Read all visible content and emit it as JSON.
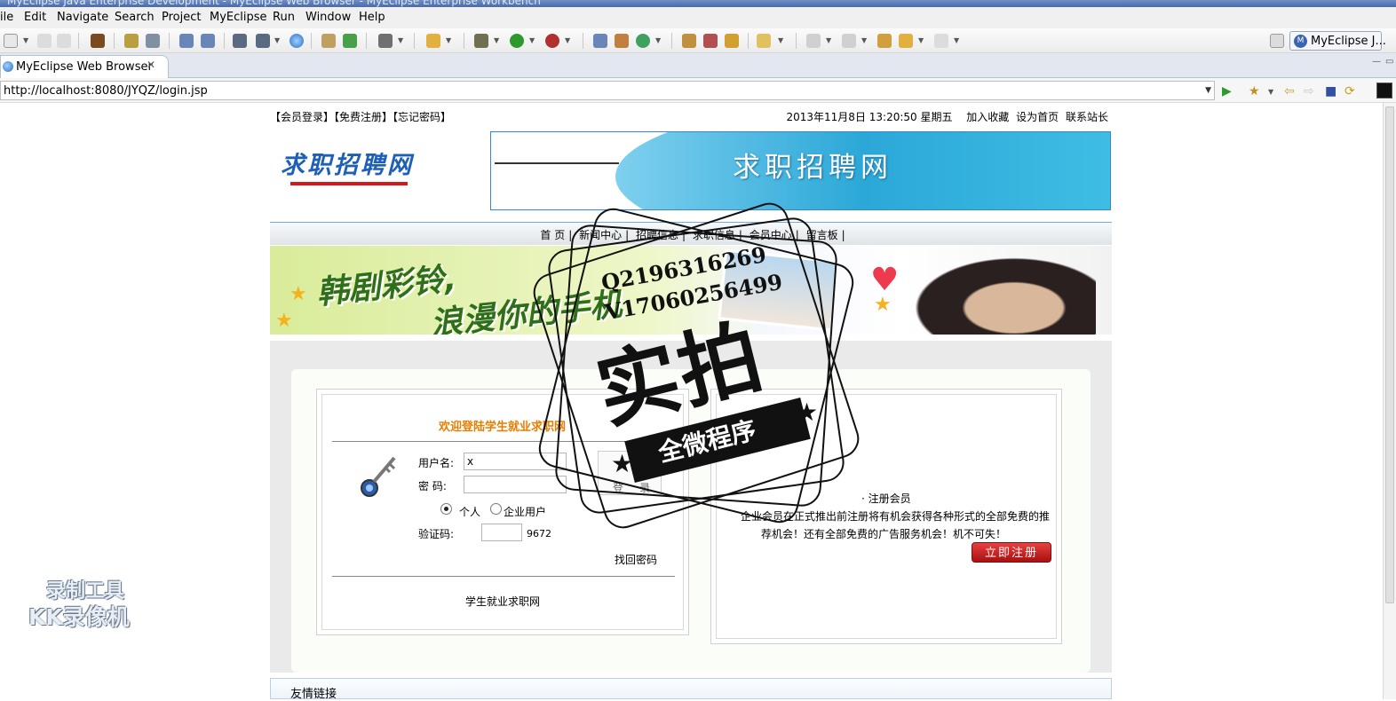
{
  "window": {
    "title": "MyEclipse Java Enterprise Development - MyEclipse Web Browser - MyEclipse Enterprise Workbench"
  },
  "menu": {
    "items": [
      "ile",
      "Edit",
      "Navigate",
      "Search",
      "Project",
      "MyEclipse",
      "Run",
      "Window",
      "Help"
    ]
  },
  "perspective": {
    "label": "MyEclipse J...",
    "icon": "myeclipse-icon"
  },
  "tab": {
    "label": "MyEclipse Web Browser",
    "close": "✕"
  },
  "browser": {
    "url": "http://localhost:8080/JYQZ/login.jsp"
  },
  "page": {
    "top_links": "【会员登录】【免费注册】【忘记密码】",
    "datetime": "2013年11月8日 13:20:50 星期五",
    "right_links": [
      "加入收藏",
      "设为首页",
      "联系站长"
    ],
    "logo_text": "求职招聘网",
    "banner_text": "求职招聘网",
    "nav": [
      "首 页",
      "新闻中心",
      "招聘信息",
      "求职信息",
      "会员中心",
      "留言板"
    ],
    "promo_line1": "韩剧彩铃,",
    "promo_line2": "浪漫你的手机",
    "login": {
      "welcome": "欢迎登陆学生就业求职网",
      "username_label": "用户名:",
      "username_value": "x",
      "password_label": "密 码:",
      "button": "登录",
      "radio_personal": "个人",
      "radio_company": "企业用户",
      "selected": "个人",
      "captcha_label": "验证码:",
      "captcha_value": "9672",
      "forgot": "找回密码",
      "footer": "学生就业求职网"
    },
    "register": {
      "title": "· 注册会员",
      "desc_line1": "企业会员在正式推出前注册将有机会获得各种形式的全部免费的推",
      "desc_line2": "荐机会！还有全部免费的广告服务机会！机不可失！",
      "button": "立即注册"
    },
    "friend_links": "友情链接"
  },
  "watermark": {
    "qq": "Q2196316269",
    "v": "V17060256499",
    "big": "实拍",
    "ribbon": "全微程序",
    "recorder_line1": "录制工具",
    "recorder_line2": "KK录像机"
  },
  "colors": {
    "accent_orange": "#e67e00",
    "register_red": "#cc2020",
    "logo_blue": "#1e5fb8",
    "banner_blue": "#2ba8d8"
  }
}
